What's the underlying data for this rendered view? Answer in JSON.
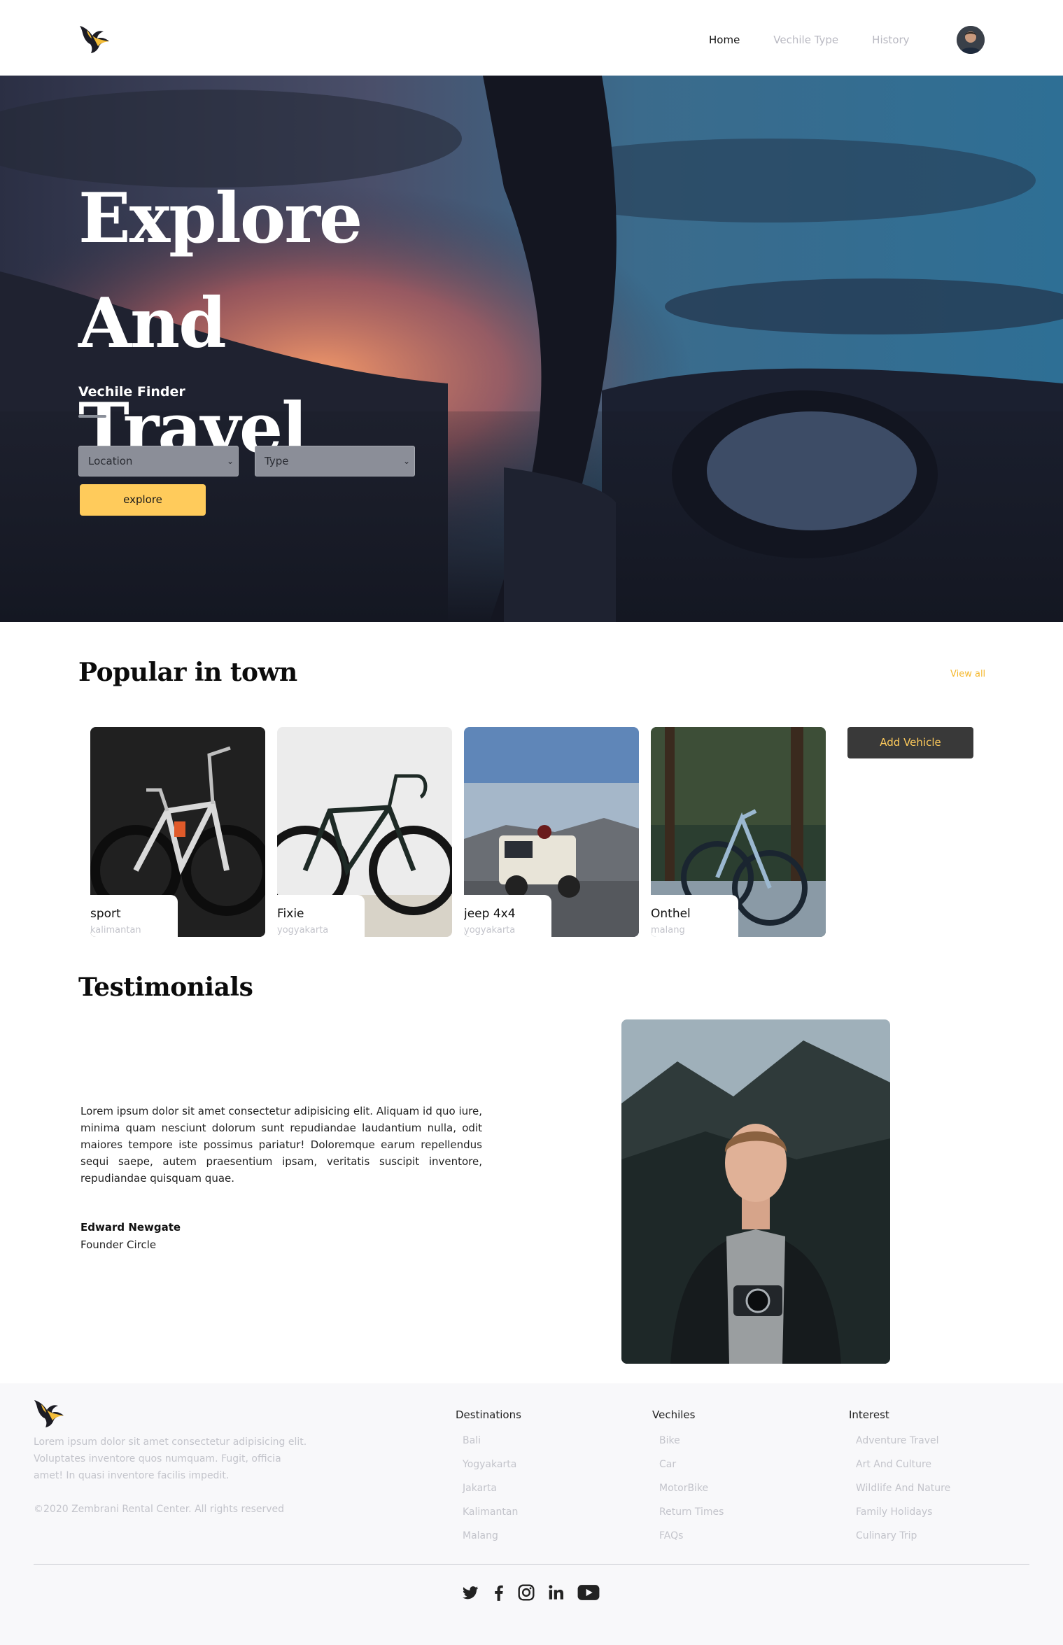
{
  "nav": {
    "links": [
      "Home",
      "Vechile Type",
      "History"
    ],
    "active": "Home"
  },
  "hero": {
    "title_line1": "Explore And",
    "title_line2": "Travel",
    "subtitle": "Vechile Finder",
    "location_select": {
      "selected": "Location"
    },
    "type_select": {
      "selected": "Type"
    },
    "explore_label": "explore"
  },
  "popular": {
    "title": "Popular in town",
    "view_all": "View all",
    "add_vehicle": "Add Vehicle",
    "cards": [
      {
        "name": "sport",
        "location": "kalimantan"
      },
      {
        "name": "Fixie",
        "location": "yogyakarta"
      },
      {
        "name": "jeep 4x4",
        "location": "yogyakarta"
      },
      {
        "name": "Onthel",
        "location": "malang"
      }
    ]
  },
  "testimonials": {
    "title": "Testimonials",
    "quote": "Lorem ipsum dolor sit amet consectetur adipisicing elit. Aliquam id quo iure, minima quam nesciunt dolorum sunt repudiandae laudantium nulla, odit maiores tempore iste possimus pariatur! Doloremque earum repellendus sequi saepe, autem praesentium ipsam, veritatis suscipit inventore, repudiandae quisquam quae.",
    "author": "Edward Newgate",
    "role": "Founder Circle"
  },
  "footer": {
    "description": "Lorem ipsum dolor sit amet consectetur adipisicing elit. Voluptates inventore quos numquam. Fugit, officia amet! In quasi inventore facilis impedit.",
    "copyright": "©2020 Zembrani Rental Center. All rights reserved",
    "columns": [
      {
        "title": "Destinations",
        "items": [
          "Bali",
          "Yogyakarta",
          "Jakarta",
          "Kalimantan",
          "Malang"
        ]
      },
      {
        "title": "Vechiles",
        "items": [
          "Bike",
          "Car",
          "MotorBike",
          "Return Times",
          "FAQs"
        ]
      },
      {
        "title": "Interest",
        "items": [
          "Adventure Travel",
          "Art And Culture",
          "Wildlife And Nature",
          "Family Holidays",
          "Culinary Trip"
        ]
      }
    ],
    "social_icons": [
      "twitter-icon",
      "facebook-icon",
      "instagram-icon",
      "linkedin-icon",
      "youtube-icon"
    ]
  },
  "colors": {
    "accent": "#ffcb5b",
    "view_all": "#f5b82e",
    "dark_button": "#393939",
    "muted_text": "#c3c4cb"
  }
}
